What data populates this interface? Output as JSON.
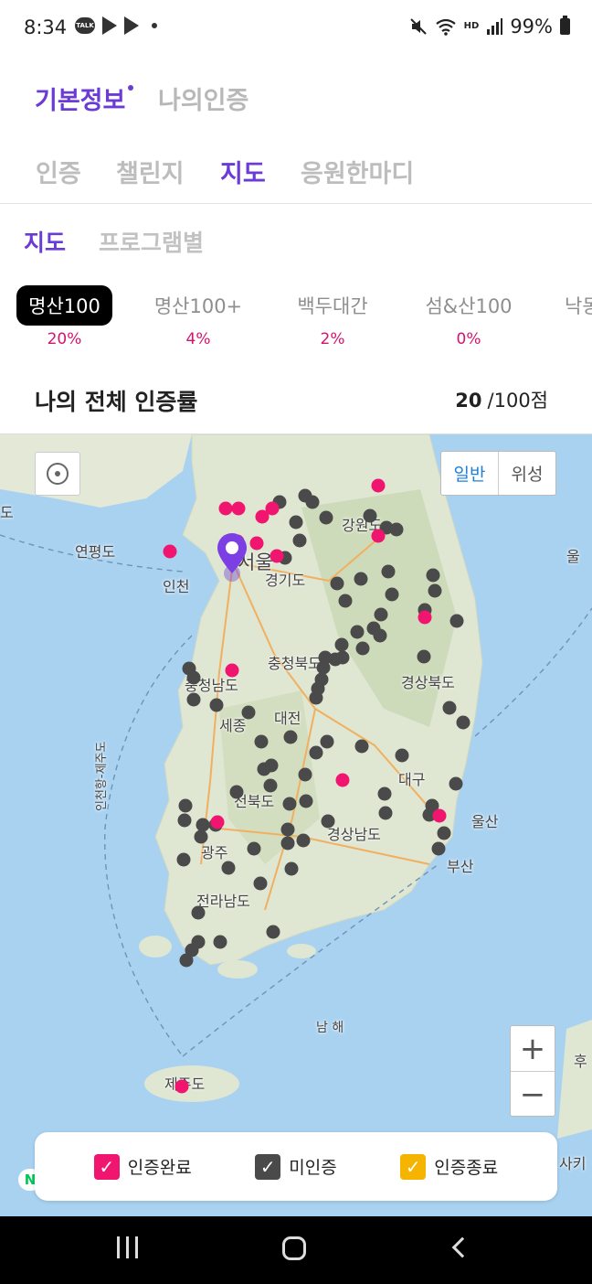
{
  "status_bar": {
    "time": "8:34",
    "talk_badge": "TALK",
    "hd_label": "HD",
    "battery": "99%"
  },
  "top_tabs": [
    {
      "label": "기본정보",
      "active": true
    },
    {
      "label": "나의인증",
      "active": false
    }
  ],
  "sub_tabs": [
    {
      "label": "인증",
      "active": false
    },
    {
      "label": "챌린지",
      "active": false
    },
    {
      "label": "지도",
      "active": true
    },
    {
      "label": "응원한마디",
      "active": false
    }
  ],
  "view_tabs": [
    {
      "label": "지도",
      "active": true
    },
    {
      "label": "프로그램별",
      "active": false
    }
  ],
  "categories": [
    {
      "label": "명산100",
      "percent": "20%",
      "active": true
    },
    {
      "label": "명산100+",
      "percent": "4%",
      "active": false
    },
    {
      "label": "백두대간",
      "percent": "2%",
      "active": false
    },
    {
      "label": "섬&산100",
      "percent": "0%",
      "active": false
    },
    {
      "label": "낙동",
      "percent": "",
      "active": false
    }
  ],
  "score": {
    "title": "나의 전체 인증률",
    "value": "20",
    "total": "/100점"
  },
  "map": {
    "type_toggle": {
      "normal": "일반",
      "satellite": "위성"
    },
    "zoom_in": "+",
    "zoom_out": "−",
    "logo": "N",
    "labels": {
      "yeonpyeong": "연평도",
      "incheon": "인천",
      "seoul": "서울",
      "gyeonggi": "경기도",
      "gangwon": "강원도",
      "chungbuk": "충청북도",
      "chungnam": "충청남도",
      "sejong": "세종",
      "daejeon": "대전",
      "gyeongbuk": "경상북도",
      "daegu": "대구",
      "jeonbuk": "전북도",
      "gyeongnam": "경상남도",
      "ulsan": "울산",
      "busan": "부산",
      "gwangju": "광주",
      "jeonnam": "전라남도",
      "namhae": "남 해",
      "jeju": "제주도",
      "route": "인천항-제주도",
      "left_edge": "도",
      "right_edge_1": "후",
      "right_edge_2": "사키",
      "sea_top_right": "울"
    },
    "colors": {
      "certified": "#f0156e",
      "uncertified": "#4a4a4a",
      "ended": "#f5b400"
    }
  },
  "legend": [
    {
      "label": "인증완료",
      "color": "#f0156e"
    },
    {
      "label": "미인증",
      "color": "#4a4a4a"
    },
    {
      "label": "인증종료",
      "color": "#f5b400"
    }
  ]
}
